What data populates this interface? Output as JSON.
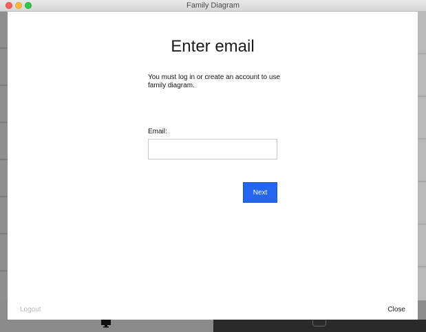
{
  "window": {
    "title": "Family Diagram"
  },
  "dialog": {
    "heading": "Enter email",
    "intro": "You must log in or create an account to use family diagram.",
    "email_label": "Email:",
    "email_value": "",
    "email_placeholder": "",
    "next_label": "Next",
    "logout_label": "Logout",
    "close_label": "Close"
  },
  "colors": {
    "accent": "#2466f0",
    "disabled_text": "#b8b8b8",
    "traffic_close": "#fc605c",
    "traffic_minimize": "#fdbc40",
    "traffic_maximize": "#34c84a"
  },
  "icons": {
    "taskbar_left": "monitor-icon",
    "taskbar_right": "laptop-icon"
  }
}
